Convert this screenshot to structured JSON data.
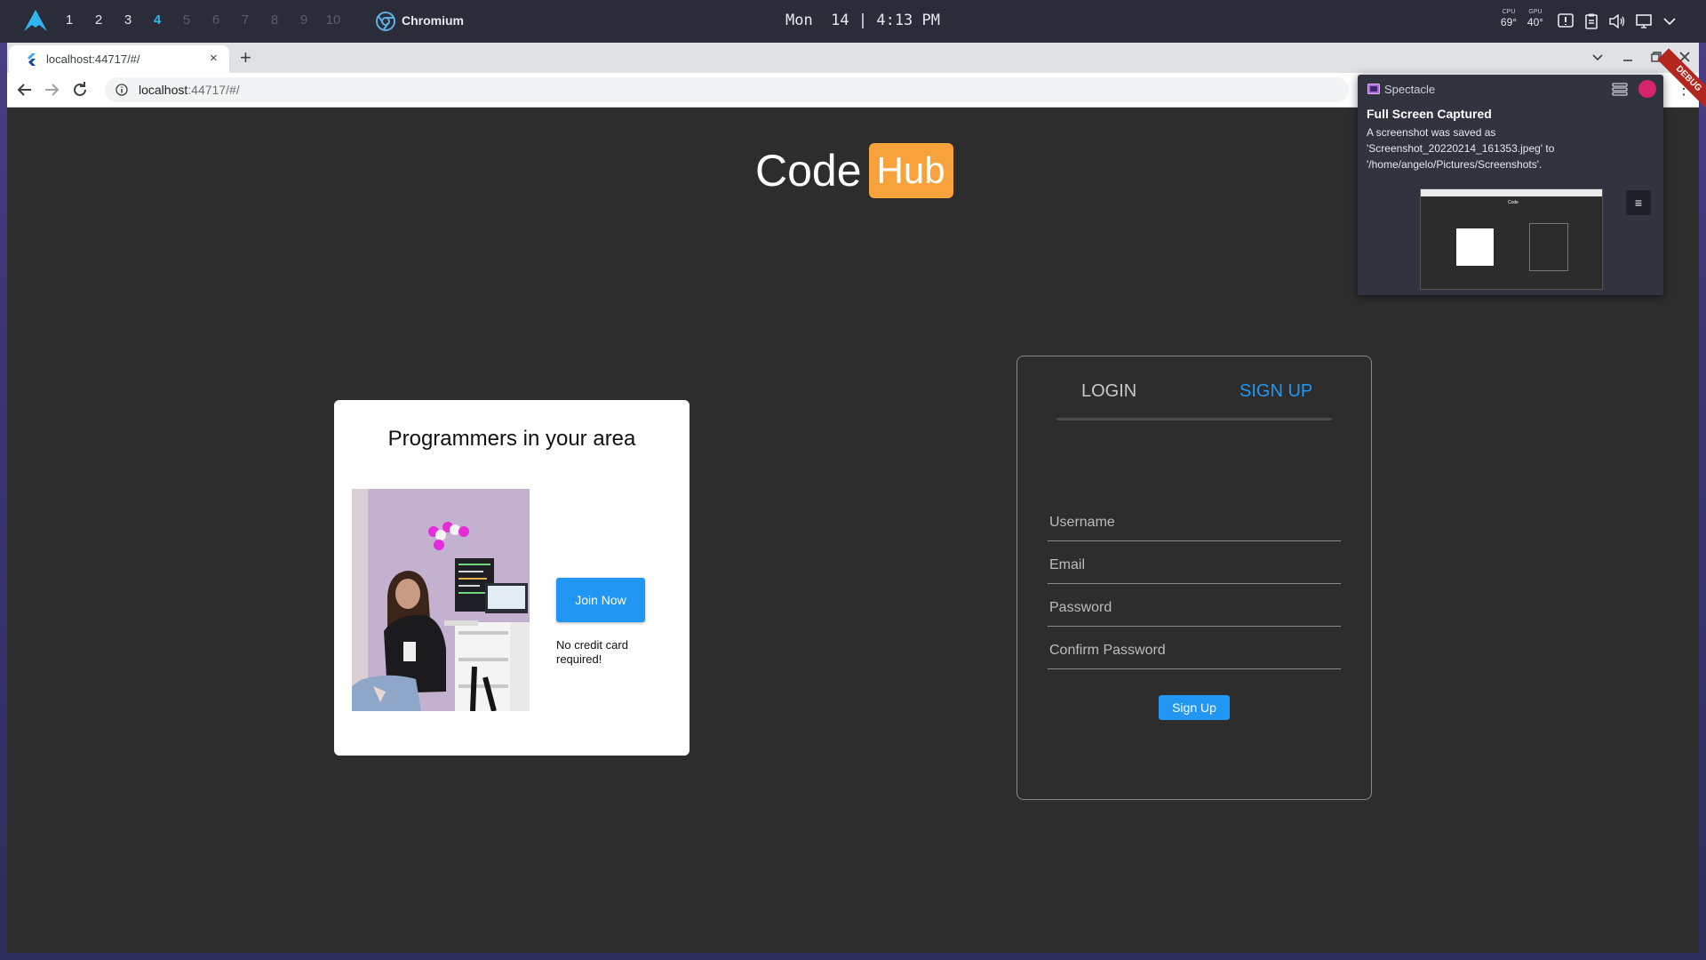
{
  "system_bar": {
    "workspaces": [
      "1",
      "2",
      "3",
      "4",
      "5",
      "6",
      "7",
      "8",
      "9",
      "10"
    ],
    "active_workspace": "4",
    "active_app": "Chromium",
    "clock": "Mon  14 | 4:13 PM",
    "cpu": {
      "label": "CPU",
      "value": "69°"
    },
    "gpu": {
      "label": "GPU",
      "value": "40°"
    },
    "tray_icons": [
      "alert-icon",
      "clipboard-icon",
      "volume-icon",
      "display-icon",
      "chevron-down-icon"
    ]
  },
  "browser": {
    "tab_title": "localhost:44717/#/",
    "url_host": "localhost",
    "url_path": ":44717/#/",
    "new_tab": "+",
    "close_tab": "×"
  },
  "page": {
    "brand_code": "Code",
    "brand_hub": "Hub",
    "brand_color": "#f7a23b",
    "debug_banner": "DEBUG",
    "promo": {
      "title": "Programmers in your area",
      "button": "Join Now",
      "note": "No credit card required!"
    },
    "auth": {
      "tab_login": "LOGIN",
      "tab_signup": "SIGN UP",
      "accent": "#2196f3",
      "fields": {
        "username": "Username",
        "email": "Email",
        "password": "Password",
        "confirm": "Confirm Password"
      },
      "submit": "Sign Up"
    }
  },
  "notification": {
    "app": "Spectacle",
    "title": "Full Screen Captured",
    "body": "A screenshot was saved as 'Screenshot_20220214_161353.jpeg' to '/home/angelo/Pictures/Screenshots'.",
    "thumb_brand": "Code"
  }
}
